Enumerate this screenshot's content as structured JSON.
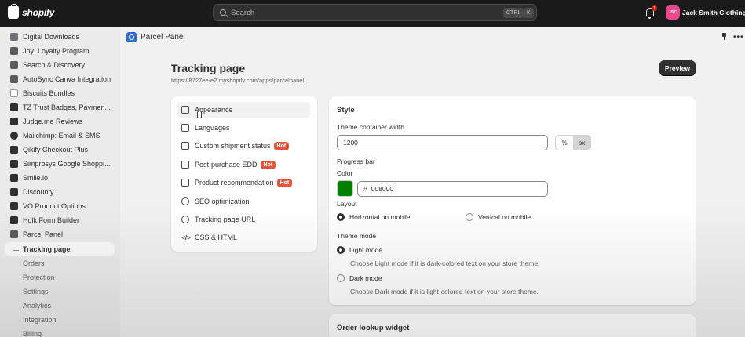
{
  "topbar": {
    "brand": "shopify",
    "search_placeholder": "Search",
    "shortcut_ctrl": "CTRL",
    "shortcut_k": "K",
    "notification_count": "1",
    "avatar_initials": "JSC",
    "store_name": "Jack Smith Clothings"
  },
  "sidebar": {
    "items": [
      {
        "label": "Digital Downloads",
        "icon": "download-icon",
        "color": "#6d7175"
      },
      {
        "label": "Joy: Loyalty Program",
        "icon": "joy-icon",
        "color": "#5c5c5c"
      },
      {
        "label": "Search & Discovery",
        "icon": "search-discovery-icon",
        "color": "#5c5c5c"
      },
      {
        "label": "AutoSync Canva Integration",
        "icon": "autosync-icon",
        "color": "#5c5c5c"
      },
      {
        "label": "Biscuits Bundles",
        "icon": "bundles-icon",
        "color": "#9a9a9a"
      },
      {
        "label": "TZ Trust Badges, Paymen...",
        "icon": "trust-badge-icon",
        "color": "#303030"
      },
      {
        "label": "Judge.me Reviews",
        "icon": "judgeme-icon",
        "color": "#303030"
      },
      {
        "label": "Mailchimp: Email & SMS",
        "icon": "mailchimp-icon",
        "color": "#303030"
      },
      {
        "label": "Qikify Checkout Plus",
        "icon": "qikify-icon",
        "color": "#303030"
      },
      {
        "label": "Simprosys Google Shoppi...",
        "icon": "simprosys-icon",
        "color": "#303030"
      },
      {
        "label": "Smile.io",
        "icon": "smile-icon",
        "color": "#303030"
      },
      {
        "label": "Discounty",
        "icon": "discounty-icon",
        "color": "#303030"
      },
      {
        "label": "VO Product Options",
        "icon": "checkbox-icon",
        "color": "#303030"
      },
      {
        "label": "Hulk Form Builder",
        "icon": "hulk-icon",
        "color": "#303030"
      },
      {
        "label": "Parcel Panel",
        "icon": "parcel-panel-icon",
        "color": "#5c5c5c"
      }
    ],
    "active_item": "Tracking page",
    "sub_items": [
      "Orders",
      "Protection",
      "Settings",
      "Analytics",
      "Integration",
      "Billing"
    ]
  },
  "appbar": {
    "app_name": "Parcel Panel"
  },
  "page": {
    "title": "Tracking page",
    "url": "https://8727ee-e2.myshopify.com/apps/parcelpanel",
    "preview_label": "Preview"
  },
  "nav": {
    "items": [
      {
        "label": "Appearance",
        "icon": "appearance-icon",
        "hot": ""
      },
      {
        "label": "Languages",
        "icon": "languages-icon",
        "hot": ""
      },
      {
        "label": "Custom shipment status",
        "icon": "shipment-status-icon",
        "hot": "Hot"
      },
      {
        "label": "Post-purchase EDD",
        "icon": "calendar-icon",
        "hot": "Hot"
      },
      {
        "label": "Product recommendation",
        "icon": "product-icon",
        "hot": "Hot"
      },
      {
        "label": "SEO optimization",
        "icon": "seo-icon",
        "hot": ""
      },
      {
        "label": "Tracking page URL",
        "icon": "link-icon",
        "hot": ""
      },
      {
        "label": "CSS & HTML",
        "icon": "code-icon",
        "hot": ""
      }
    ]
  },
  "style": {
    "heading": "Style",
    "width_label": "Theme container width",
    "width_value": "1200",
    "unit_percent": "%",
    "unit_px": "px",
    "progress_label": "Progress bar",
    "color_label": "Color",
    "color_hash": "#",
    "color_value": "008000",
    "swatch_color": "#008000",
    "layout_label": "Layout",
    "layout_horizontal": "Horizontal on mobile",
    "layout_vertical": "Vertical on mobile",
    "theme_mode_label": "Theme mode",
    "light_mode": "Light mode",
    "light_help": "Choose Light mode if it is dark-colored text on your store theme.",
    "dark_mode": "Dark mode",
    "dark_help": "Choose Dark mode if it is light-colored text on your store theme."
  },
  "lookup": {
    "title": "Order lookup widget"
  }
}
